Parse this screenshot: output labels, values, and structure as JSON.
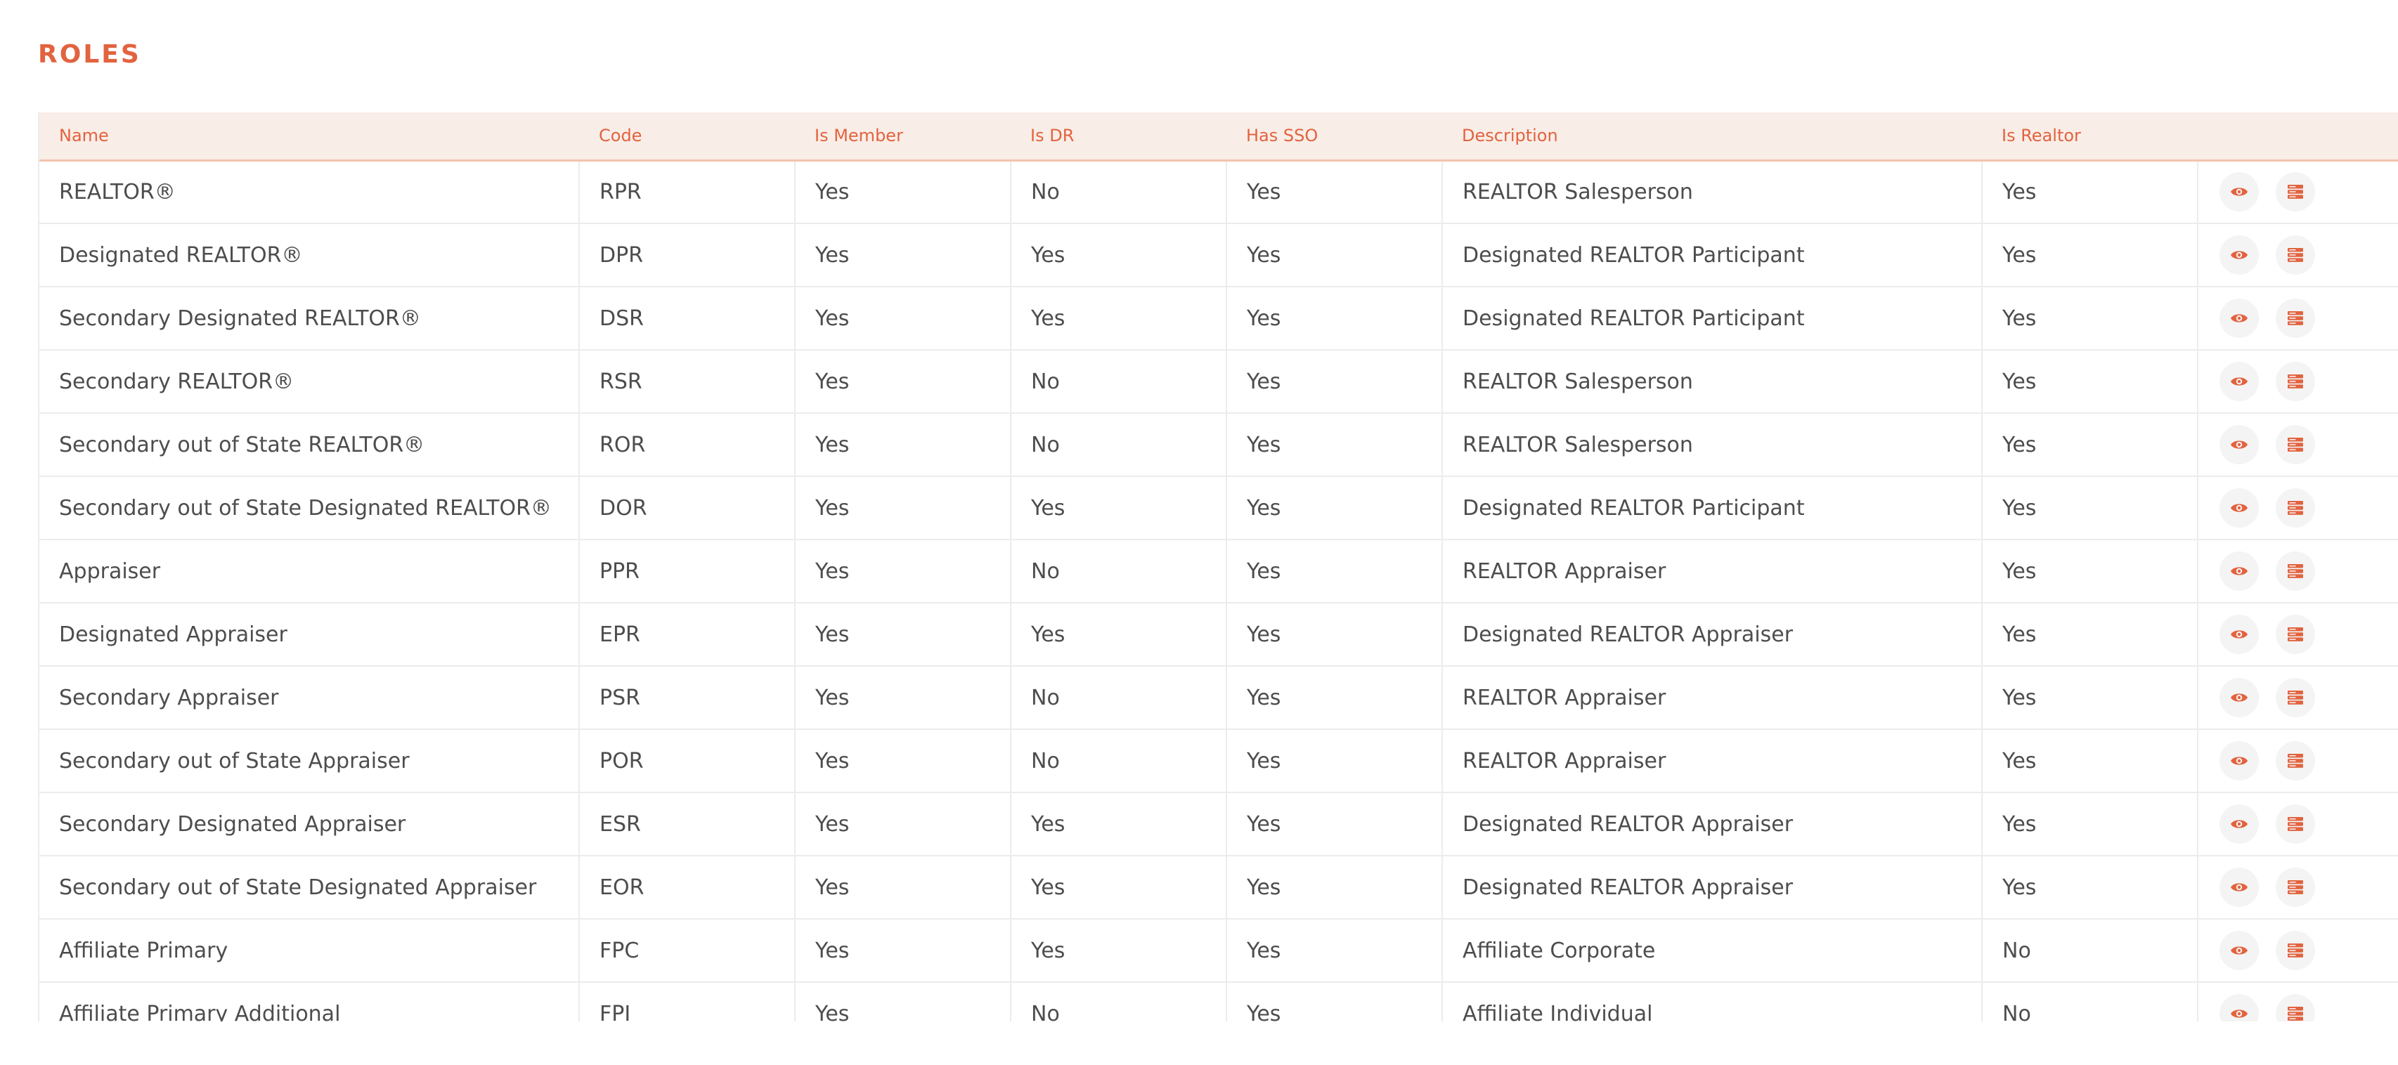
{
  "page": {
    "title": "ROLES"
  },
  "colors": {
    "accent": "#e2633f",
    "header_bg": "#f9ede7",
    "text": "#4d4d4d"
  },
  "table": {
    "headers": {
      "name": "Name",
      "code": "Code",
      "is_member": "Is Member",
      "is_dr": "Is DR",
      "has_sso": "Has SSO",
      "description": "Description",
      "is_realtor": "Is Realtor"
    },
    "row_actions": [
      "eye-icon",
      "server-icon"
    ],
    "rows": [
      {
        "name": "REALTOR®",
        "code": "RPR",
        "is_member": "Yes",
        "is_dr": "No",
        "has_sso": "Yes",
        "description": "REALTOR Salesperson",
        "is_realtor": "Yes"
      },
      {
        "name": "Designated REALTOR®",
        "code": "DPR",
        "is_member": "Yes",
        "is_dr": "Yes",
        "has_sso": "Yes",
        "description": "Designated REALTOR Participant",
        "is_realtor": "Yes"
      },
      {
        "name": "Secondary Designated REALTOR®",
        "code": "DSR",
        "is_member": "Yes",
        "is_dr": "Yes",
        "has_sso": "Yes",
        "description": "Designated REALTOR Participant",
        "is_realtor": "Yes"
      },
      {
        "name": "Secondary REALTOR®",
        "code": "RSR",
        "is_member": "Yes",
        "is_dr": "No",
        "has_sso": "Yes",
        "description": "REALTOR Salesperson",
        "is_realtor": "Yes"
      },
      {
        "name": "Secondary out of State REALTOR®",
        "code": "ROR",
        "is_member": "Yes",
        "is_dr": "No",
        "has_sso": "Yes",
        "description": "REALTOR Salesperson",
        "is_realtor": "Yes"
      },
      {
        "name": "Secondary out of State Designated REALTOR®",
        "code": "DOR",
        "is_member": "Yes",
        "is_dr": "Yes",
        "has_sso": "Yes",
        "description": "Designated REALTOR Participant",
        "is_realtor": "Yes"
      },
      {
        "name": "Appraiser",
        "code": "PPR",
        "is_member": "Yes",
        "is_dr": "No",
        "has_sso": "Yes",
        "description": "REALTOR Appraiser",
        "is_realtor": "Yes"
      },
      {
        "name": "Designated Appraiser",
        "code": "EPR",
        "is_member": "Yes",
        "is_dr": "Yes",
        "has_sso": "Yes",
        "description": "Designated REALTOR Appraiser",
        "is_realtor": "Yes"
      },
      {
        "name": "Secondary Appraiser",
        "code": "PSR",
        "is_member": "Yes",
        "is_dr": "No",
        "has_sso": "Yes",
        "description": "REALTOR Appraiser",
        "is_realtor": "Yes"
      },
      {
        "name": "Secondary out of State Appraiser",
        "code": "POR",
        "is_member": "Yes",
        "is_dr": "No",
        "has_sso": "Yes",
        "description": "REALTOR Appraiser",
        "is_realtor": "Yes"
      },
      {
        "name": "Secondary Designated Appraiser",
        "code": "ESR",
        "is_member": "Yes",
        "is_dr": "Yes",
        "has_sso": "Yes",
        "description": "Designated REALTOR Appraiser",
        "is_realtor": "Yes"
      },
      {
        "name": "Secondary out of State Designated Appraiser",
        "code": "EOR",
        "is_member": "Yes",
        "is_dr": "Yes",
        "has_sso": "Yes",
        "description": "Designated REALTOR Appraiser",
        "is_realtor": "Yes"
      },
      {
        "name": "Affiliate Primary",
        "code": "FPC",
        "is_member": "Yes",
        "is_dr": "Yes",
        "has_sso": "Yes",
        "description": "Affiliate Corporate",
        "is_realtor": "No"
      },
      {
        "name": "Affiliate Primary Additional",
        "code": "FPI",
        "is_member": "Yes",
        "is_dr": "No",
        "has_sso": "Yes",
        "description": "Affiliate Individual",
        "is_realtor": "No"
      }
    ]
  }
}
